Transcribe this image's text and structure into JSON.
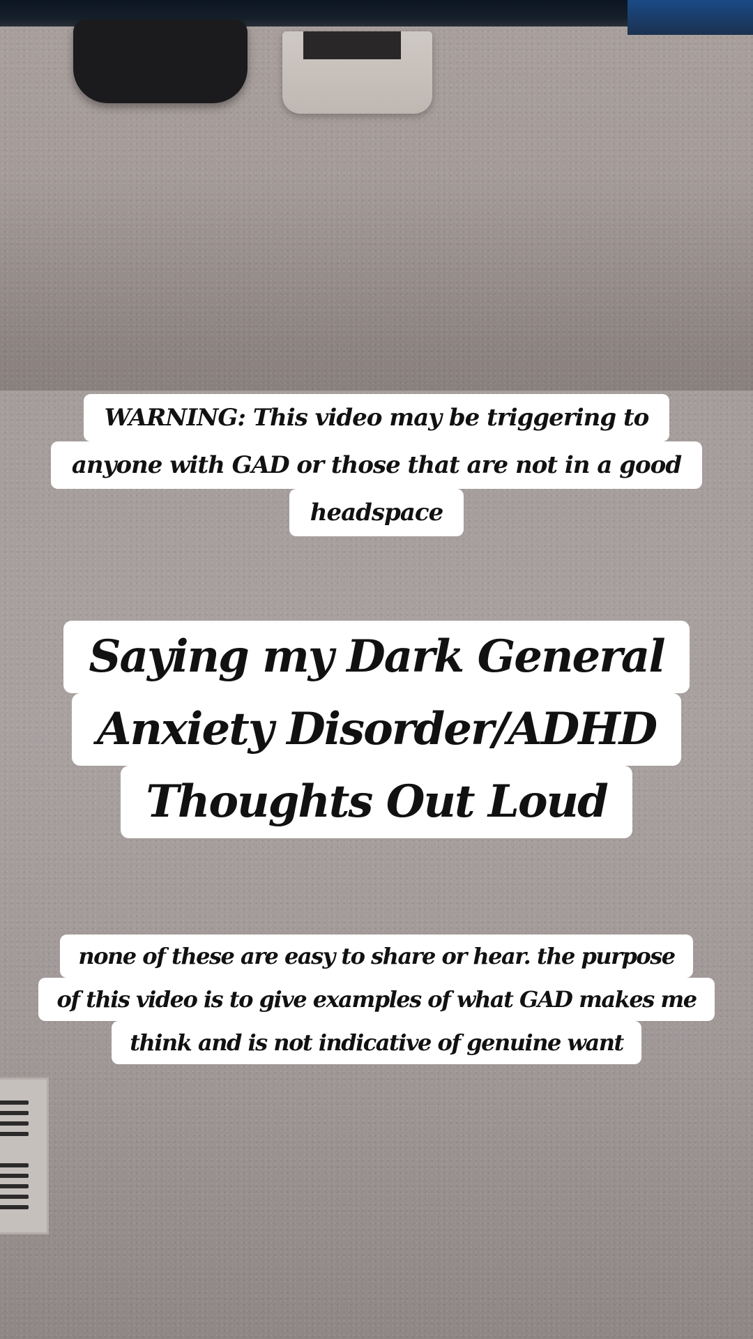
{
  "captions": {
    "warning": {
      "lines": [
        "WARNING: This video may be triggering to",
        "anyone with GAD or those that are not in a good",
        "headspace"
      ]
    },
    "title": {
      "lines": [
        "Saying my Dark General",
        "Anxiety Disorder/ADHD",
        "Thoughts Out Loud"
      ]
    },
    "note": {
      "lines": [
        "none of these are easy to share or hear.  the purpose",
        "of this video is to give examples of what GAD makes me",
        "think and is not indicative of genuine want"
      ]
    }
  },
  "scene": {
    "wall_color": "#a9a1a0",
    "ceiling_color": "#a59c99",
    "caption_background": "#ffffff",
    "caption_text_color": "#111111"
  }
}
